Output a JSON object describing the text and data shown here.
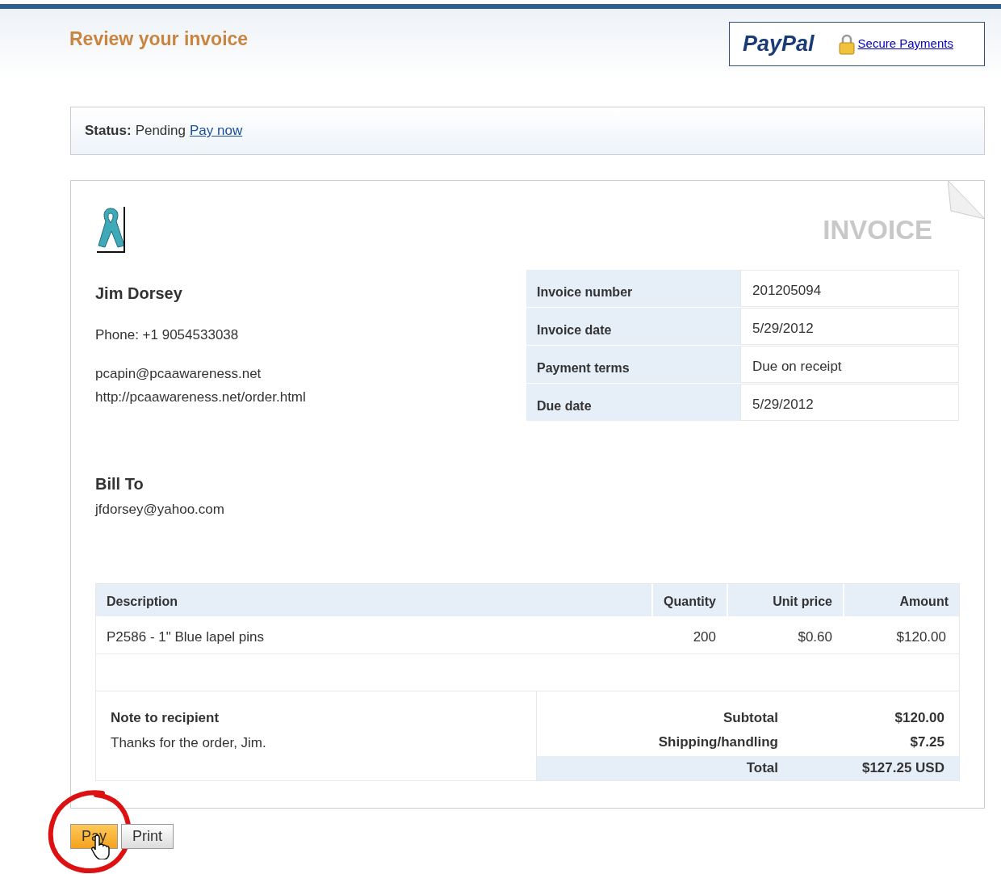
{
  "header": {
    "title": "Review your invoice",
    "brand": "PayPal",
    "secure_link": "Secure Payments"
  },
  "status": {
    "label": "Status:",
    "value": "Pending",
    "link": "Pay now"
  },
  "invoice": {
    "heading": "INVOICE",
    "sender": {
      "name": "Jim Dorsey",
      "phone": "Phone: +1 9054533038",
      "email": "pcapin@pcaawareness.net",
      "website": "http://pcaawareness.net/order.html"
    },
    "details": [
      {
        "label": "Invoice number",
        "value": "201205094"
      },
      {
        "label": "Invoice date",
        "value": "5/29/2012"
      },
      {
        "label": "Payment terms",
        "value": "Due on receipt"
      },
      {
        "label": "Due date",
        "value": "5/29/2012"
      }
    ],
    "bill_to": {
      "heading": "Bill To",
      "email": "jfdorsey@yahoo.com"
    },
    "items": {
      "columns": [
        "Description",
        "Quantity",
        "Unit price",
        "Amount"
      ],
      "rows": [
        [
          "P2586 - 1\" Blue lapel pins",
          "200",
          "$0.60",
          "$120.00"
        ]
      ]
    },
    "note": {
      "heading": "Note to recipient",
      "text": "Thanks for the order, Jim."
    },
    "totals": [
      {
        "label": "Subtotal",
        "value": "$120.00",
        "highlight": false
      },
      {
        "label": "Shipping/handling",
        "value": "$7.25",
        "highlight": false
      },
      {
        "label": "Total",
        "value": "$127.25 USD",
        "highlight": true
      }
    ]
  },
  "buttons": [
    {
      "label": "Pay",
      "kind": "primary",
      "circled": true
    },
    {
      "label": "Print",
      "kind": "secondary",
      "circled": false
    }
  ]
}
